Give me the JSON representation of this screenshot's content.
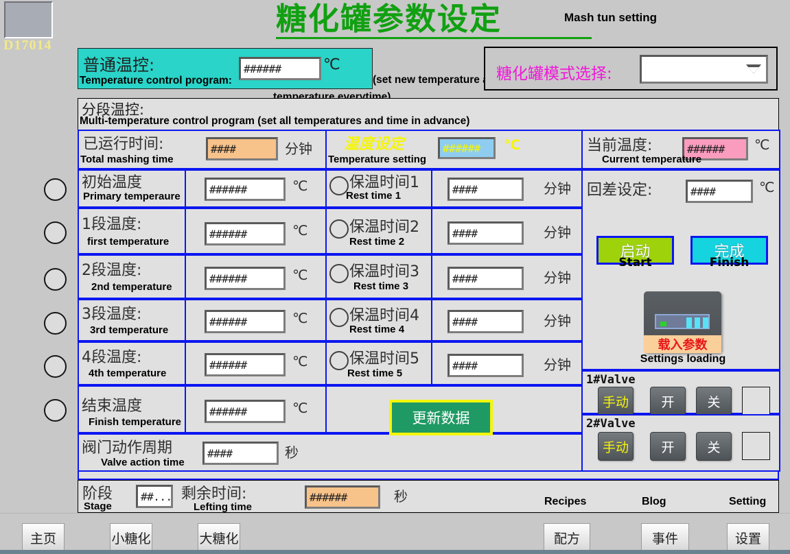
{
  "device": {
    "tag": "D17014"
  },
  "header": {
    "title_cn": "糖化罐参数设定",
    "title_en": "Mash tun setting"
  },
  "simple_control": {
    "label_cn": "普通温控:",
    "label_en": "Temperature control program:",
    "note_line1": "(set new temperature after finishing a last",
    "note_line2": "temperature everytime)",
    "value": "######",
    "unit": "℃"
  },
  "mode_select": {
    "label_cn": "糖化罐模式选择:",
    "value": "",
    "icon": "chevron-down-icon"
  },
  "multi_control": {
    "label_cn": "分段温控:",
    "label_en": "Multi-temperature control program (set all temperatures and time in advance)"
  },
  "summary": {
    "total_time": {
      "label_cn": "已运行时间:",
      "label_en": "Total mashing time",
      "value": "####",
      "unit": "分钟"
    },
    "temp_setting": {
      "label_cn": "温度设定",
      "label_en": "Temperature setting",
      "value": "######",
      "unit": "℃"
    },
    "current_temp": {
      "label_cn": "当前温度:",
      "label_en": "Current temperature",
      "value": "######",
      "unit": "℃"
    }
  },
  "temperatures": [
    {
      "label_cn": "初始温度",
      "label_en": "Primary temperaure",
      "value": "######",
      "unit": "℃"
    },
    {
      "label_cn": "1段温度:",
      "label_en": "first temperature",
      "value": "######",
      "unit": "℃"
    },
    {
      "label_cn": "2段温度:",
      "label_en": "2nd temperature",
      "value": "######",
      "unit": "℃"
    },
    {
      "label_cn": "3段温度:",
      "label_en": "3rd temperature",
      "value": "######",
      "unit": "℃"
    },
    {
      "label_cn": "4段温度:",
      "label_en": "4th temperature",
      "value": "######",
      "unit": "℃"
    },
    {
      "label_cn": "结束温度",
      "label_en": "Finish temperature",
      "value": "######",
      "unit": "℃"
    }
  ],
  "rest_times": [
    {
      "label_cn": "保温时间1",
      "label_en": "Rest time 1",
      "value": "####",
      "unit": "分钟"
    },
    {
      "label_cn": "保温时间2",
      "label_en": "Rest time 2",
      "value": "####",
      "unit": "分钟"
    },
    {
      "label_cn": "保温时间3",
      "label_en": "Rest time 3",
      "value": "####",
      "unit": "分钟"
    },
    {
      "label_cn": "保温时间4",
      "label_en": "Rest time 4",
      "value": "####",
      "unit": "分钟"
    },
    {
      "label_cn": "保温时间5",
      "label_en": "Rest time 5",
      "value": "####",
      "unit": "分钟"
    }
  ],
  "valve_action": {
    "label_cn": "阀门动作周期",
    "label_en": "Valve action time",
    "value": "####",
    "unit": "秒"
  },
  "hysteresis": {
    "label_cn": "回差设定:",
    "value": "####",
    "unit": "℃"
  },
  "actions": {
    "start": {
      "cn": "启动",
      "en": "Start"
    },
    "finish": {
      "cn": "完成",
      "en": "Finish"
    },
    "update": {
      "cn": "更新数据"
    },
    "settings_loading": {
      "cn": "载入参数",
      "en": "Settings loading",
      "icon": "download-arrow-icon"
    }
  },
  "valves": [
    {
      "title": "1#Valve",
      "manual": "手动",
      "open": "开",
      "close": "关"
    },
    {
      "title": "2#Valve",
      "manual": "手动",
      "open": "开",
      "close": "关"
    }
  ],
  "stage": {
    "label_cn": "阶段",
    "label_en": "Stage",
    "value": "##...",
    "remaining_cn": "剩余时间:",
    "remaining_en": "Lefting time",
    "remaining_value": "######",
    "remaining_unit": "秒"
  },
  "taskbar": {
    "home": "主页",
    "small_mash": "小糖化",
    "large_mash": "大糖化",
    "recipes_label": "Recipes",
    "recipes": "配方",
    "blog_label": "Blog",
    "blog": "事件",
    "setting_label": "Setting",
    "setting": "设置"
  },
  "colors": {
    "title_green": "#11a011",
    "teal": "#2ad4c8",
    "magenta": "#f018d8",
    "grid_blue": "#0b16f0",
    "start_green": "#9ed30c",
    "finish_cyan": "#16d3e0",
    "update_green": "#1f9a64",
    "accent_yellow": "#f5f50a",
    "orange_field": "#f8c38a",
    "blue_field": "#8fcdf0",
    "pink_field": "#fa9cbe"
  }
}
